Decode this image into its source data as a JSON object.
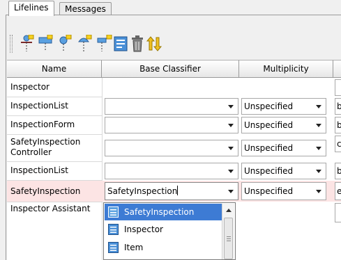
{
  "tabs": [
    {
      "label": "Lifelines",
      "active": true
    },
    {
      "label": "Messages",
      "active": false
    }
  ],
  "toolbar": {
    "icons": [
      "add-lifeline-icon",
      "add-lifeline-variant-icon",
      "insert-lifeline-icon",
      "add-actor-lifeline-icon",
      "add-nested-lifeline-icon",
      "properties-icon",
      "delete-icon",
      "move-up-down-icon"
    ]
  },
  "table": {
    "columns": [
      "Name",
      "Base Classifier",
      "Multiplicity"
    ],
    "rows": [
      {
        "name": "Inspector",
        "classifier": "",
        "multiplicity": "",
        "extra": ""
      },
      {
        "name": "InspectionList",
        "classifier": "",
        "multiplicity": "Unspecified",
        "extra": "b"
      },
      {
        "name": "InspectionForm",
        "classifier": "",
        "multiplicity": "Unspecified",
        "extra": "b"
      },
      {
        "name": "SafetyInspection Controller",
        "classifier": "",
        "multiplicity": "Unspecified",
        "extra": "c"
      },
      {
        "name": "InspectionList",
        "classifier": "",
        "multiplicity": "Unspecified",
        "extra": "b"
      },
      {
        "name": "SafetyInspection",
        "classifier": "SafetyInspection",
        "multiplicity": "Unspecified",
        "extra": "e"
      },
      {
        "name": "Inspector Assistant",
        "classifier": "",
        "multiplicity": "",
        "extra": ""
      }
    ]
  },
  "dropdown": {
    "items": [
      "SafetyInspection",
      "Inspector",
      "Item"
    ],
    "highlighted": 0
  },
  "colors": {
    "highlight": "#3d7bd4",
    "selected_row": "#fce4e4"
  }
}
